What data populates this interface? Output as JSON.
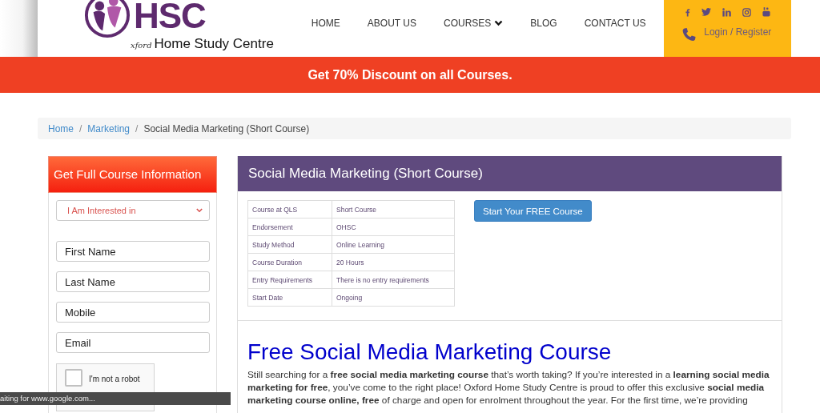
{
  "header": {
    "logo": {
      "mark": "HSC",
      "prefix": "xford",
      "name": "Home Study Centre"
    },
    "nav": [
      {
        "label": "HOME",
        "dropdown": false
      },
      {
        "label": "ABOUT US",
        "dropdown": false
      },
      {
        "label": "COURSES",
        "dropdown": true
      },
      {
        "label": "BLOG",
        "dropdown": false
      },
      {
        "label": "CONTACT US",
        "dropdown": false
      }
    ],
    "social": [
      {
        "kind": "facebook"
      },
      {
        "kind": "twitter"
      },
      {
        "kind": "linkedin"
      },
      {
        "kind": "instagram"
      },
      {
        "kind": "youtube"
      }
    ],
    "login": "Login / Register"
  },
  "promo": "Get 70% Discount on all Courses.",
  "breadcrumb_separator": "/",
  "breadcrumb": [
    {
      "label": "Home",
      "current": false
    },
    {
      "label": "Marketing",
      "current": false
    },
    {
      "label": "Social Media Marketing (Short Course)",
      "current": true
    }
  ],
  "enquiry": {
    "title": "Get Full Course Information",
    "select": {
      "placeholder": "I Am Interested in"
    },
    "fields": [
      {
        "placeholder": "First Name"
      },
      {
        "placeholder": "Last Name"
      },
      {
        "placeholder": "Mobile"
      },
      {
        "placeholder": "Email"
      }
    ],
    "captcha": {
      "label": "I'm not a robot",
      "checked": false
    }
  },
  "course": {
    "title": "Social Media Marketing (Short Course)",
    "details": [
      {
        "label": "Course at QLS",
        "value": "Short Course"
      },
      {
        "label": "Endorsement",
        "value": "OHSC"
      },
      {
        "label": "Study Method",
        "value": "Online Learning"
      },
      {
        "label": "Course Duration",
        "value": "20 Hours"
      },
      {
        "label": "Entry Requirements",
        "value": "There is no entry requirements"
      },
      {
        "label": "Start Date",
        "value": "Ongoing"
      }
    ],
    "cta": "Start Your FREE Course",
    "heading": "Free Social Media Marketing Course",
    "intro": "Still searching for a **free social media marketing course** that’s worth taking? If you’re interested in a **learning social media marketing for free**, you’ve come to the right place!  Oxford Home Study Centre is proud to offer this exclusive **social media marketing course online, free** of charge and open for enrolment throughout the year.  For the first time, we’re providing"
  },
  "status_bar": "aiting for www.google.com..."
}
